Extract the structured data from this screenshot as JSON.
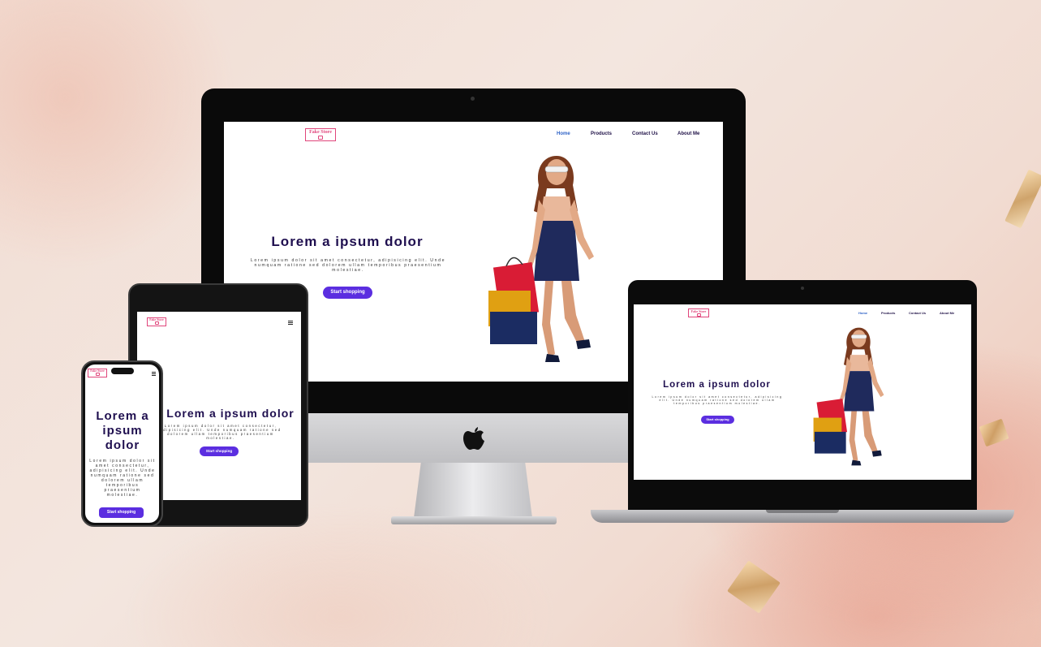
{
  "brand": {
    "logo_text": "Fake Store"
  },
  "nav": {
    "items": [
      "Home",
      "Products",
      "Contact Us",
      "About Me"
    ],
    "active": "Home"
  },
  "hero": {
    "title": "Lorem a ipsum dolor",
    "text": "Lorem ipsum dolor sit amet consectetur, adipisicing elit. Unde numquam ratione sed dolorem ullam temporibus praesentium molestiae.",
    "cta": "Start shopping"
  },
  "colors": {
    "accent": "#5b2ee0",
    "logo": "#e0457b",
    "title": "#1f0f4f",
    "nav_active": "#2f63c7"
  },
  "icons": {
    "menu": "hamburger-menu-icon",
    "logo_mark": "shopping-bag-icon",
    "apple": "apple-logo-icon"
  }
}
